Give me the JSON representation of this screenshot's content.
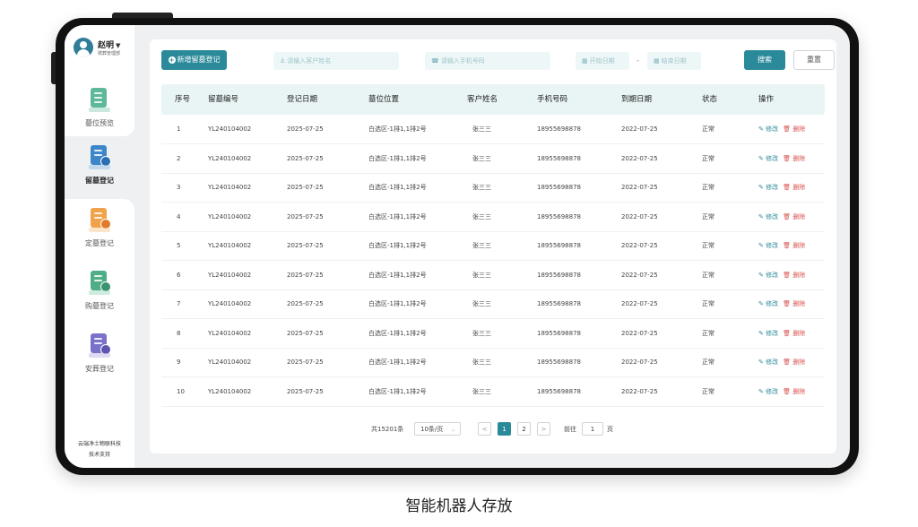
{
  "user": {
    "name": "赵明",
    "role": "殡葬管理部"
  },
  "sidebar": {
    "items": [
      {
        "label": "墓位预览",
        "icon": "building-icon"
      },
      {
        "label": "留墓登记",
        "icon": "document-clock-icon"
      },
      {
        "label": "定墓登记",
        "icon": "document-coin-icon"
      },
      {
        "label": "购墓登记",
        "icon": "document-check-icon"
      },
      {
        "label": "安葬登记",
        "icon": "document-person-icon"
      }
    ],
    "active": 1,
    "footer_company": "云端净土物联科技",
    "footer_support": "技术支持"
  },
  "toolbar": {
    "new_label": "新增留墓登记",
    "customer_placeholder": "请输入客户姓名",
    "phone_placeholder": "请输入手机号码",
    "start_date_placeholder": "开始日期",
    "date_separator": "-",
    "end_date_placeholder": "结束日期",
    "search_label": "搜索",
    "reset_label": "重置"
  },
  "table": {
    "headers": [
      "序号",
      "留墓编号",
      "登记日期",
      "墓位位置",
      "客户姓名",
      "手机号码",
      "到期日期",
      "状态",
      "操作"
    ],
    "edit_label": "修改",
    "delete_label": "删除",
    "rows": [
      [
        "1",
        "YL240104002",
        "2025-07-25",
        "白选区-1排1,1排2号",
        "张三三",
        "18955698878",
        "2022-07-25",
        "正常"
      ],
      [
        "2",
        "YL240104002",
        "2025-07-25",
        "白选区-1排1,1排2号",
        "张三三",
        "18955698878",
        "2022-07-25",
        "正常"
      ],
      [
        "3",
        "YL240104002",
        "2025-07-25",
        "白选区-1排1,1排2号",
        "张三三",
        "18955698878",
        "2022-07-25",
        "正常"
      ],
      [
        "4",
        "YL240104002",
        "2025-07-25",
        "白选区-1排1,1排2号",
        "张三三",
        "18955698878",
        "2022-07-25",
        "正常"
      ],
      [
        "5",
        "YL240104002",
        "2025-07-25",
        "白选区-1排1,1排2号",
        "张三三",
        "18955698878",
        "2022-07-25",
        "正常"
      ],
      [
        "6",
        "YL240104002",
        "2025-07-25",
        "白选区-1排1,1排2号",
        "张三三",
        "18955698878",
        "2022-07-25",
        "正常"
      ],
      [
        "7",
        "YL240104002",
        "2025-07-25",
        "白选区-1排1,1排2号",
        "张三三",
        "18955698878",
        "2022-07-25",
        "正常"
      ],
      [
        "8",
        "YL240104002",
        "2025-07-25",
        "白选区-1排1,1排2号",
        "张三三",
        "18955698878",
        "2022-07-25",
        "正常"
      ],
      [
        "9",
        "YL240104002",
        "2025-07-25",
        "白选区-1排1,1排2号",
        "张三三",
        "18955698878",
        "2022-07-25",
        "正常"
      ],
      [
        "10",
        "YL240104002",
        "2025-07-25",
        "白选区-1排1,1排2号",
        "张三三",
        "18955698878",
        "2022-07-25",
        "正常"
      ]
    ]
  },
  "pagination": {
    "total": "共15201条",
    "page_size": "10条/页",
    "prev": "<",
    "next": ">",
    "pages": [
      "1",
      "2"
    ],
    "current": "1",
    "goto_label": "前往",
    "goto_value": "1",
    "goto_suffix": "页"
  },
  "caption": "智能机器人存放",
  "colors": {
    "accent": "#2b8a9a",
    "danger": "#d9534f",
    "header_bg": "#e9f4f5"
  }
}
